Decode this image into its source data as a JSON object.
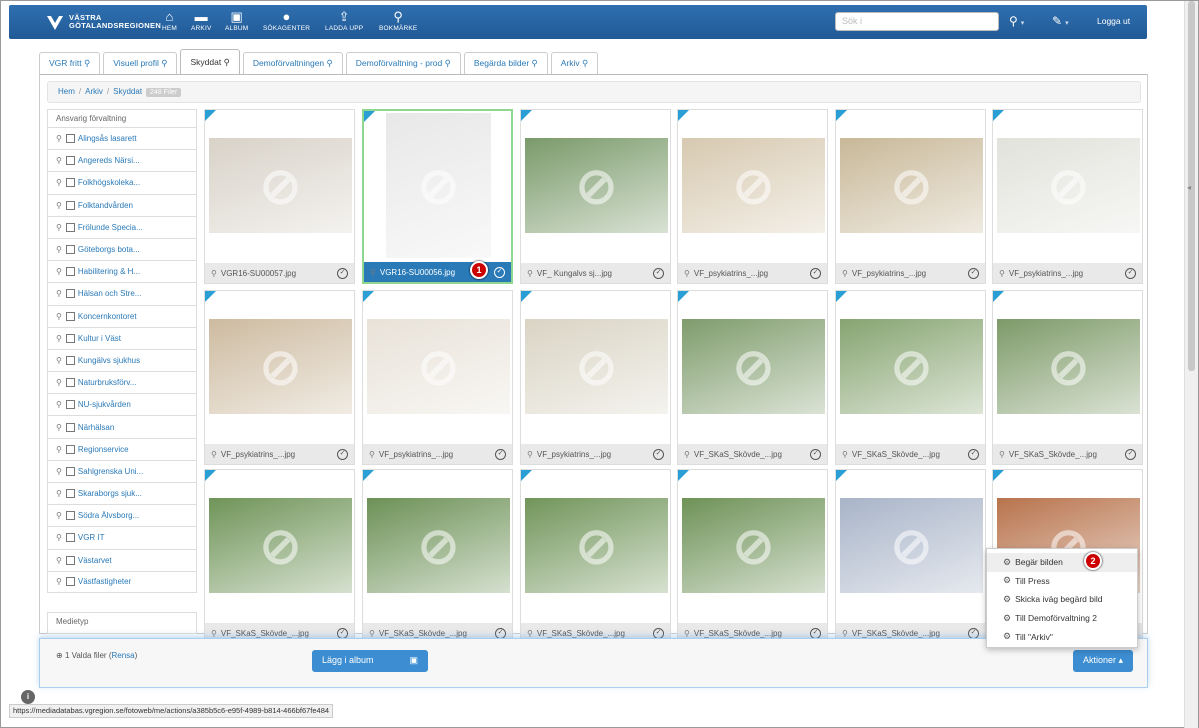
{
  "header": {
    "logo_line1": "VÄSTRA",
    "logo_line2": "GÖTALANDSREGIONEN",
    "nav": [
      {
        "label": "HEM",
        "icon": "home-icon"
      },
      {
        "label": "ARKIV",
        "icon": "folder-icon"
      },
      {
        "label": "ALBUM",
        "icon": "briefcase-icon"
      },
      {
        "label": "SÖKAGENTER",
        "icon": "alert-icon"
      },
      {
        "label": "LADDA UPP",
        "icon": "upload-icon"
      },
      {
        "label": "BOKMÄRKE",
        "icon": "pin-icon"
      }
    ],
    "search_placeholder": "Sök i",
    "logout": "Logga ut"
  },
  "tabs": [
    "VGR fritt",
    "Visuell profil",
    "Skyddat",
    "Demoförvaltningen",
    "Demoförvaltning - prod",
    "Begärda bilder",
    "Arkiv"
  ],
  "active_tab": "Skyddat",
  "breadcrumb": {
    "items": [
      "Hem",
      "Arkiv",
      "Skyddat"
    ],
    "count": "248 Filer"
  },
  "sidebar": {
    "heading": "Ansvarig förvaltning",
    "items": [
      "Alingsås lasarett",
      "Angereds Närsi...",
      "Folkhögskoleka...",
      "Folktandvården",
      "Frölunde Specia...",
      "Göteborgs bota...",
      "Habilitering & H...",
      "Hälsan och Stre...",
      "Koncernkontoret",
      "Kultur i Väst",
      "Kungälvs sjukhus",
      "Naturbruksförv...",
      "NU-sjukvården",
      "Närhälsan",
      "Regionservice",
      "Sahlgrenska Uni...",
      "Skaraborgs sjuk...",
      "Södra Älvsborg...",
      "VGR IT",
      "Västarvet",
      "Västfastigheter"
    ],
    "second_heading": "Medietyp"
  },
  "cards": [
    {
      "name": "VGR16-SU00057.jpg",
      "color": "#d8d2c8"
    },
    {
      "name": "VGR16-SU00056.jpg",
      "color": "#e8e8e8",
      "selected": true
    },
    {
      "name": "VF_ Kungalvs sj...jpg",
      "color": "#7a9a6a"
    },
    {
      "name": "VF_psykiatrins_...jpg",
      "color": "#d7c9b0"
    },
    {
      "name": "VF_psykiatrins_...jpg",
      "color": "#c8b898"
    },
    {
      "name": "VF_psykiatrins_...jpg",
      "color": "#e2e2dc"
    },
    {
      "name": "VF_psykiatrins_...jpg",
      "color": "#cdbba0"
    },
    {
      "name": "VF_psykiatrins_...jpg",
      "color": "#e8e2d8"
    },
    {
      "name": "VF_psykiatrins_...jpg",
      "color": "#d9d4c4"
    },
    {
      "name": "VF_SKaS_Skövde_...jpg",
      "color": "#7f9c6c"
    },
    {
      "name": "VF_SKaS_Skövde_...jpg",
      "color": "#86a470"
    },
    {
      "name": "VF_SKaS_Skövde_...jpg",
      "color": "#7d9a68"
    },
    {
      "name": "VF_SKaS_Skövde_...jpg",
      "color": "#6f9458"
    },
    {
      "name": "VF_SKaS_Skövde_...jpg",
      "color": "#6c9156"
    },
    {
      "name": "VF_SKaS_Skövde_...jpg",
      "color": "#71955a"
    },
    {
      "name": "VF_SKaS_Skövde_...jpg",
      "color": "#6e9257"
    },
    {
      "name": "VF_SKaS_Skövde_...jpg",
      "color": "#a8b4c8"
    },
    {
      "name": "VF_SKaS_Skövde_...jpg",
      "color": "#b8734c"
    }
  ],
  "badges": {
    "one": "1",
    "two": "2"
  },
  "dropdown": [
    "Begär bilden",
    "Till Press",
    "Skicka iväg begärd bild",
    "Till Demoförvaltning 2",
    "Till \"Arkiv\""
  ],
  "bottom": {
    "selected_text": "1 Valda filer",
    "clear_link": "Rensa",
    "add_album": "Lägg i album",
    "actions": "Aktioner"
  },
  "status_url": "https://mediadatabas.vgregion.se/fotoweb/me/actions/a385b5c6-e95f-4989-b814-466bf67fe484",
  "colors": {
    "accent": "#2a7ab8",
    "nav": "#2f6fb0",
    "badge": "#cc0000"
  }
}
